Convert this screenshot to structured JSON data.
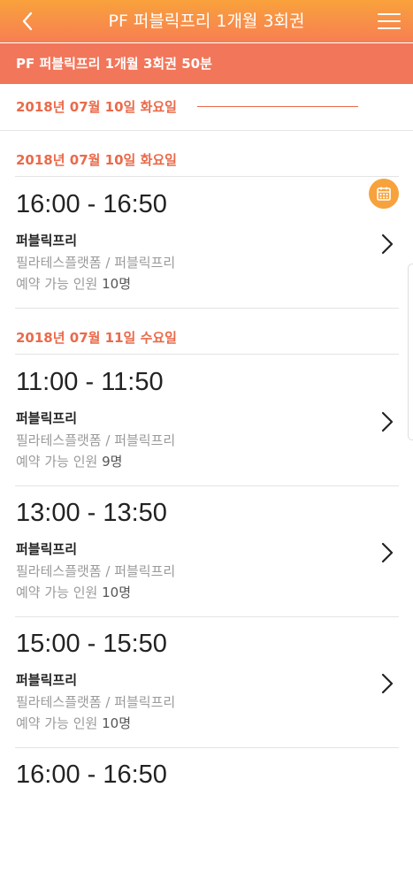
{
  "header": {
    "title": "PF 퍼블릭프리 1개월 3회권"
  },
  "subheader": {
    "title": "PF 퍼블릭프리 1개월 3회권 50분"
  },
  "date_bar": {
    "selected_date": "2018년 07월 10일 화요일",
    "calendar_icon": "calendar-icon"
  },
  "colors": {
    "accent": "#ea6a4a",
    "header_gradient_top": "#f9a23c",
    "header_gradient_bottom": "#f77e52",
    "subheader": "#f2765a"
  },
  "sections": [
    {
      "date": "2018년 07월 10일 화요일",
      "slots": [
        {
          "time": "16:00 - 16:50",
          "name": "퍼블릭프리",
          "place": "필라테스플랫폼 / 퍼블릭프리",
          "available_label": "예약 가능 인원",
          "available_count": "10명"
        }
      ]
    },
    {
      "date": "2018년 07월 11일 수요일",
      "slots": [
        {
          "time": "11:00 - 11:50",
          "name": "퍼블릭프리",
          "place": "필라테스플랫폼 / 퍼블릭프리",
          "available_label": "예약 가능 인원",
          "available_count": "9명"
        },
        {
          "time": "13:00 - 13:50",
          "name": "퍼블릭프리",
          "place": "필라테스플랫폼 / 퍼블릭프리",
          "available_label": "예약 가능 인원",
          "available_count": "10명"
        },
        {
          "time": "15:00 - 15:50",
          "name": "퍼블릭프리",
          "place": "필라테스플랫폼 / 퍼블릭프리",
          "available_label": "예약 가능 인원",
          "available_count": "10명"
        },
        {
          "time": "16:00 - 16:50"
        }
      ]
    }
  ]
}
